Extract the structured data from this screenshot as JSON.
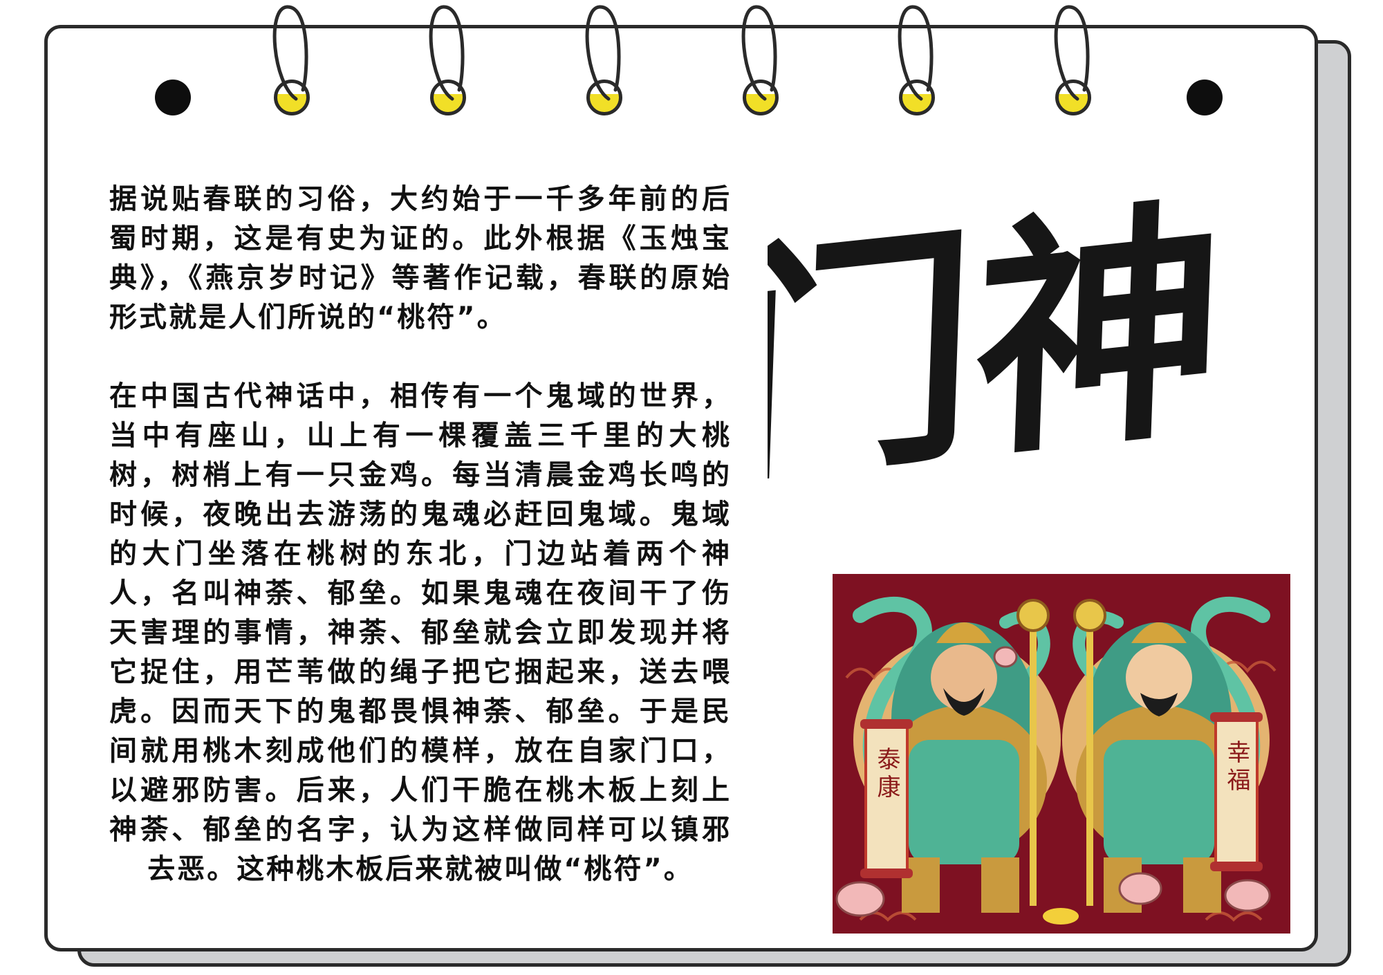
{
  "paragraph1": {
    "text": "据说贴春联的习俗，大约始于一千多年前的后蜀时期，这是有史为证的。此外根据《玉烛宝典》，《燕京岁时记》等著作记载，春联的原始形式就是人们所说的“桃符”。"
  },
  "paragraph2": {
    "text": "在中国古代神话中，相传有一个鬼域的世界，当中有座山，山上有一棵覆盖三千里的大桃树，树梢上有一只金鸡。每当清晨金鸡长鸣的时候，夜晚出去游荡的鬼魂必赶回鬼域。鬼域的大门坐落在桃树的东北，门边站着两个神人，名叫神荼、郁垒。如果鬼魂在夜间干了伤天害理的事情，神荼、郁垒就会立即发现并将它捉住，用芒苇做的绳子把它捆起来，送去喂虎。因而天下的鬼都畏惧神荼、郁垒。于是民间就用桃木刻成他们的模样，放在自家门口，以避邪防害。后来，人们干脆在桃木板上刻上神荼、郁垒的名字，认为这样做同样可以镇邪去恶。这种桃木板后来就被叫做“桃符”。"
  },
  "title": {
    "text": "门神"
  },
  "illustration": {
    "left_scroll_text": "泰康",
    "right_scroll_text": "幸福"
  },
  "colors": {
    "page": "#ffffff",
    "back_page": "#cfd0d2",
    "outline": "#2a2a2a",
    "ring_fill": "#f1df27",
    "ink": "#111111",
    "illustration_background": "#7e1122",
    "illustration_accent": "#5fc3a4"
  }
}
